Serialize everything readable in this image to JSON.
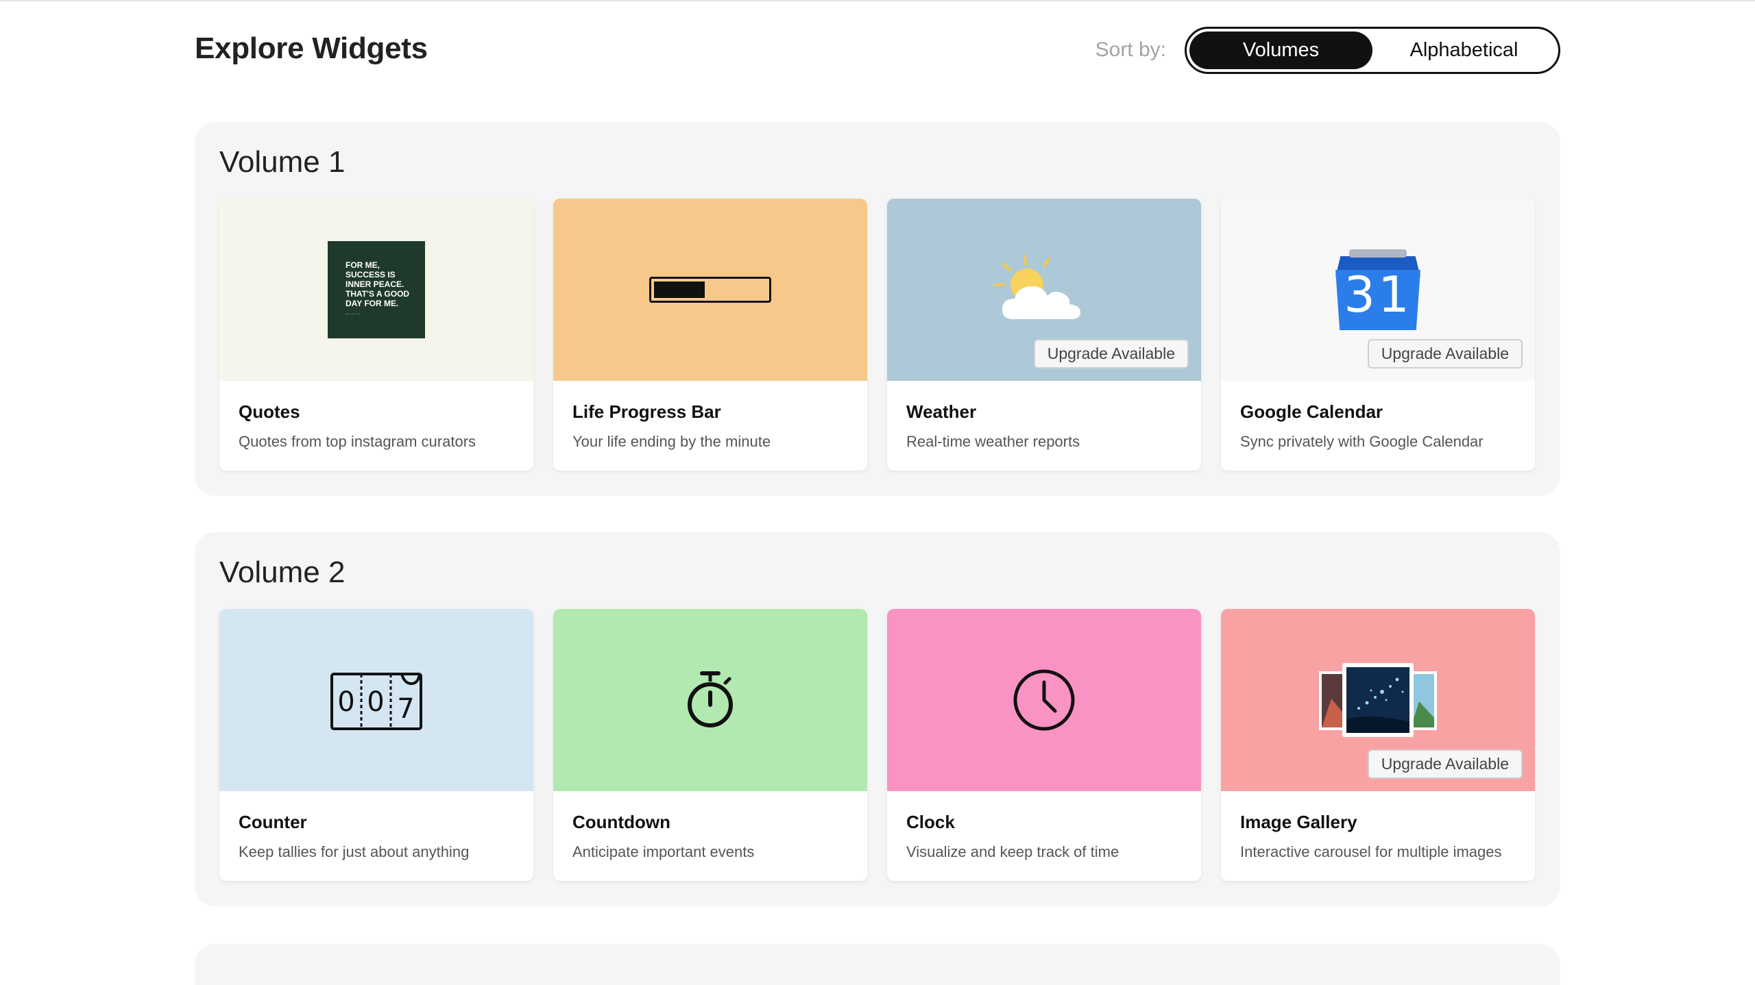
{
  "header": {
    "title": "Explore Widgets",
    "sort_label": "Sort by:",
    "sort_options": [
      "Volumes",
      "Alphabetical"
    ],
    "sort_selected": "Volumes"
  },
  "volumes": [
    {
      "title": "Volume 1",
      "cards": [
        {
          "title": "Quotes",
          "desc": "Quotes from top instagram curators",
          "bg": "#f6f5ec",
          "icon": "quote-image-icon",
          "quote_text": "FOR ME, SUCCESS IS INNER PEACE. THAT'S A GOOD DAY FOR ME."
        },
        {
          "title": "Life Progress Bar",
          "desc": "Your life ending by the minute",
          "bg": "#f6c98a",
          "icon": "progress-bar-icon",
          "progress": 0.45
        },
        {
          "title": "Weather",
          "desc": "Real-time weather reports",
          "bg": "#adc8d6",
          "icon": "sun-cloud-icon",
          "badge": "Upgrade Available"
        },
        {
          "title": "Google Calendar",
          "desc": "Sync privately with Google Calendar",
          "bg": "#f8f8f8",
          "icon": "calendar-icon",
          "badge": "Upgrade Available",
          "calendar_day": "31"
        }
      ]
    },
    {
      "title": "Volume 2",
      "cards": [
        {
          "title": "Counter",
          "desc": "Keep tallies for just about anything",
          "bg": "#d3e6f2",
          "icon": "counter-icon",
          "counter_digits": [
            "0",
            "0",
            "7"
          ]
        },
        {
          "title": "Countdown",
          "desc": "Anticipate important events",
          "bg": "#b1e9b0",
          "icon": "stopwatch-icon"
        },
        {
          "title": "Clock",
          "desc": "Visualize and keep track of time",
          "bg": "#f993c3",
          "icon": "clock-icon"
        },
        {
          "title": "Image Gallery",
          "desc": "Interactive carousel for multiple images",
          "bg": "#f9a2a4",
          "icon": "image-gallery-icon",
          "badge": "Upgrade Available"
        }
      ]
    }
  ]
}
